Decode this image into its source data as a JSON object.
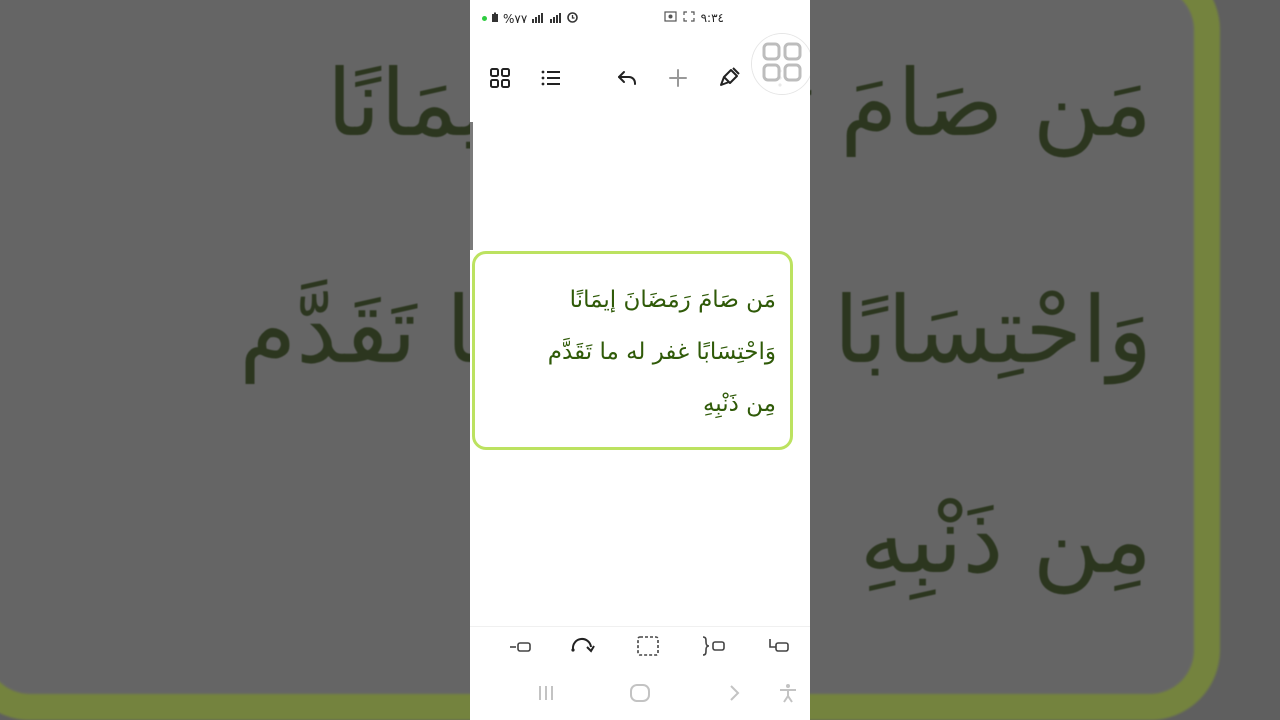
{
  "background": {
    "lines": [
      "مَن صَامَ رَمَضَانَ إيمَانًا",
      "وَاحْتِسَابًا غفر له ما تَقَدَّم",
      "مِن ذَنْبِهِ"
    ]
  },
  "status": {
    "battery": "%٧٧",
    "time": "٩:٣٤"
  },
  "toolbar": {
    "icons": [
      "grid-icon",
      "list-icon",
      "undo-icon",
      "plus-icon",
      "pen-icon",
      "more-icon"
    ]
  },
  "card": {
    "lines": [
      "مَن صَامَ رَمَضَانَ إيمَانًا",
      "وَاحْتِسَابًا غفر له ما تَقَدَّم",
      "مِن ذَنْبِهِ"
    ]
  },
  "bottom_tools": [
    "connector-left-icon",
    "redo-curve-icon",
    "select-box-icon",
    "bracket-icon",
    "connector-right-icon"
  ],
  "navbar": [
    "recents-icon",
    "home-icon",
    "back-icon",
    "accessibility-icon"
  ],
  "colors": {
    "accent_green": "#bce260",
    "text_green": "#2f5a08"
  }
}
